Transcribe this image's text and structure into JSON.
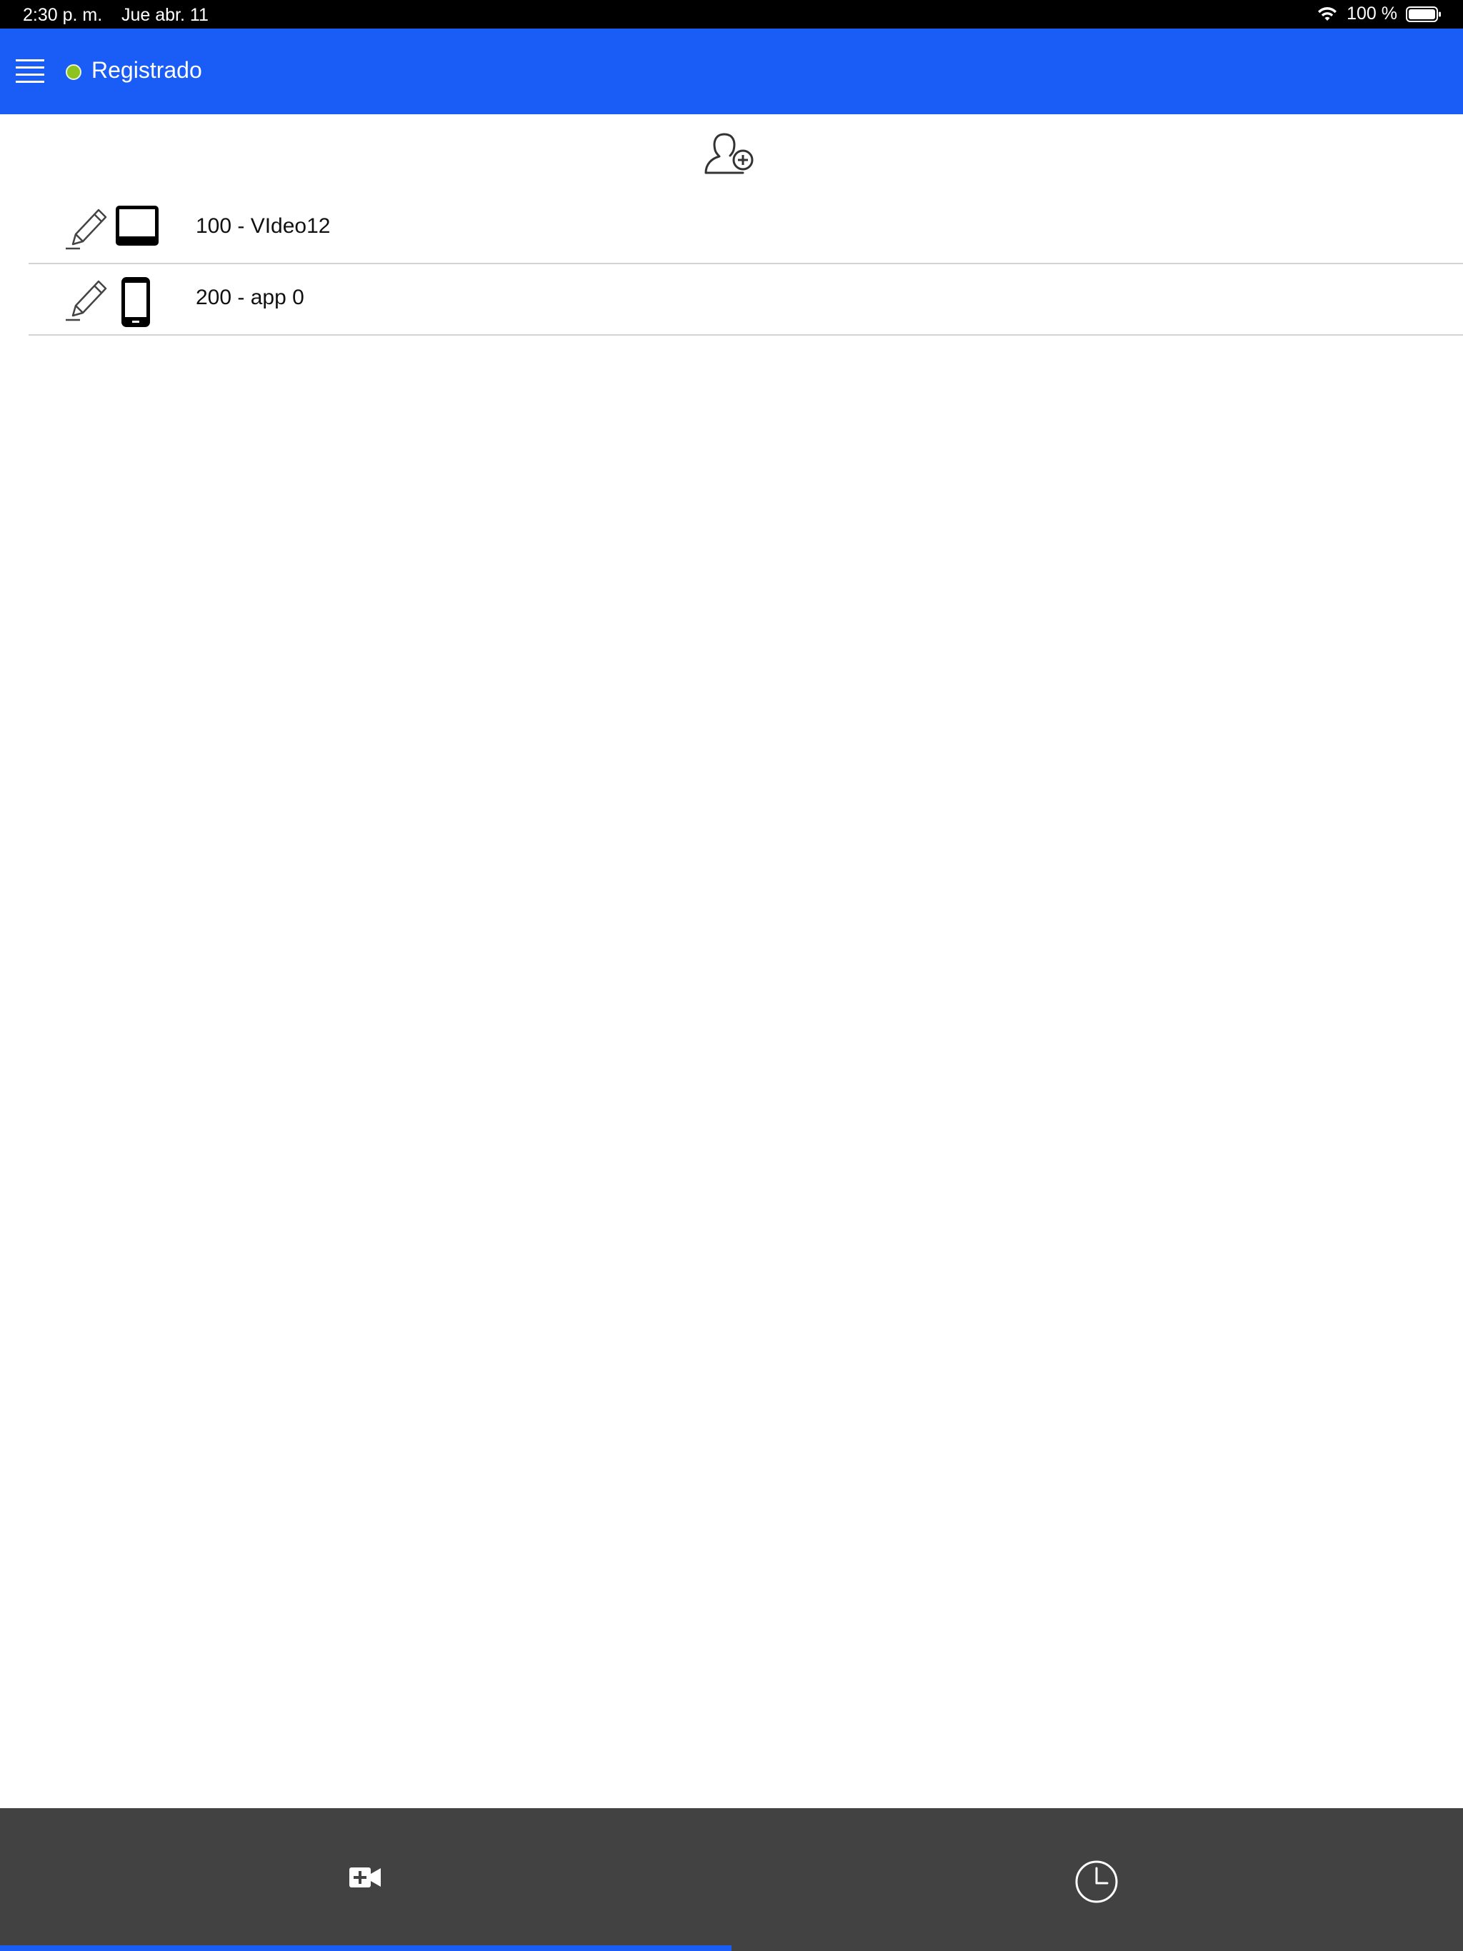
{
  "status_bar": {
    "time": "2:30 p. m.",
    "date": "Jue abr. 11",
    "battery": "100 %",
    "wifi_icon": "wifi-icon",
    "battery_icon": "battery-full-icon"
  },
  "header": {
    "menu_icon": "hamburger-menu-icon",
    "status_label": "Registrado",
    "status_color": "#8ec21e",
    "background": "#1a5cf6"
  },
  "toolbar": {
    "add_contact_icon": "add-user-icon"
  },
  "contacts": [
    {
      "label": "100 - VIdeo12",
      "device_icon": "tablet-icon",
      "edit_icon": "pencil-icon"
    },
    {
      "label": "200 - app 0",
      "device_icon": "smartphone-icon",
      "edit_icon": "pencil-icon"
    }
  ],
  "tab_bar": {
    "background": "#424242",
    "tabs": [
      {
        "icon": "video-call-add-icon",
        "selected": true
      },
      {
        "icon": "clock-history-icon",
        "selected": false
      }
    ],
    "indicator_color": "#1a5cf6"
  }
}
